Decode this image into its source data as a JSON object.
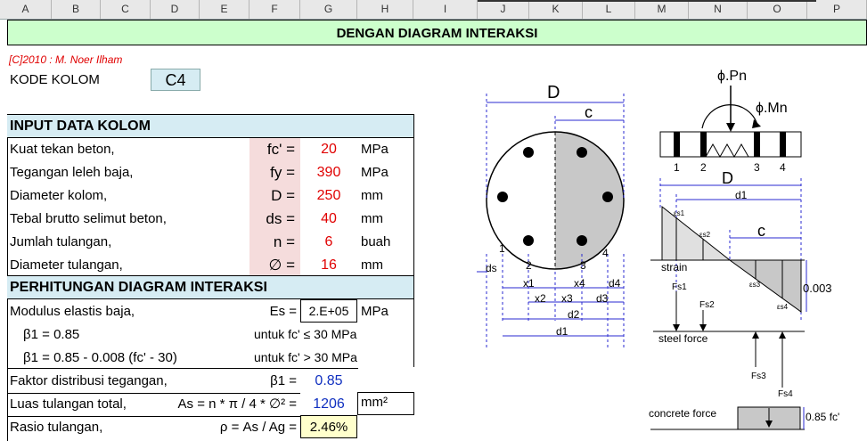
{
  "columns": [
    "A",
    "B",
    "C",
    "D",
    "E",
    "F",
    "G",
    "H",
    "I",
    "J",
    "K",
    "L",
    "M",
    "N",
    "O",
    "P"
  ],
  "title": "DENGAN DIAGRAM INTERAKSI",
  "credit": "[C]2010 : M. Noer Ilham",
  "kode": {
    "label": "KODE KOLOM",
    "value": "C4"
  },
  "input_header": "INPUT DATA KOLOM",
  "inputs": [
    {
      "label": "Kuat tekan beton,",
      "sym": "fc' =",
      "value": "20",
      "unit": "MPa"
    },
    {
      "label": "Tegangan leleh baja,",
      "sym": "fy =",
      "value": "390",
      "unit": "MPa"
    },
    {
      "label": "Diameter kolom,",
      "sym": "D =",
      "value": "250",
      "unit": "mm"
    },
    {
      "label": "Tebal brutto selimut beton,",
      "sym": "ds =",
      "value": "40",
      "unit": "mm"
    },
    {
      "label": "Jumlah tulangan,",
      "sym": "n =",
      "value": "6",
      "unit": "buah"
    },
    {
      "label": "Diameter tulangan,",
      "sym": "∅ =",
      "value": "16",
      "unit": "mm"
    }
  ],
  "calc_header": "PERHITUNGAN DIAGRAM INTERAKSI",
  "calc": {
    "modulus": {
      "label": "Modulus elastis baja,",
      "sym": "Es =",
      "value": "2.E+05",
      "unit": "MPa"
    },
    "beta_a": {
      "label": "β1 =  0.85",
      "cond": "untuk fc' ≤ 30 MPa"
    },
    "beta_b": {
      "label": "β1 =  0.85 - 0.008 (fc' - 30)",
      "cond": "untuk fc' > 30 MPa"
    },
    "faktor": {
      "label": "Faktor distribusi tegangan,",
      "sym": "β1 =",
      "value": "0.85"
    },
    "luas": {
      "label": "Luas tulangan total,",
      "formula": "As = n * π / 4 * ∅² =",
      "value": "1206",
      "unit": "mm²"
    },
    "rasio": {
      "label": "Rasio tulangan,",
      "formula": "ρ = As / Ag =",
      "value": "2.46%"
    }
  },
  "diagram": {
    "D": "D",
    "c": "c",
    "ds": "ds",
    "x1": "x1",
    "x2": "x2",
    "x3": "x3",
    "x4": "x4",
    "d1": "d1",
    "d2": "d2",
    "d3": "d3",
    "d4": "d4",
    "bars": [
      "1",
      "2",
      "3",
      "4"
    ],
    "phiPn": "ϕ.Pn",
    "phiMn": "ϕ.Mn",
    "strain": "strain",
    "strain_val": "0.003",
    "steel_force": "steel force",
    "concrete_force": "concrete force",
    "conc_val": "0.85 fc'",
    "eps": [
      "εs1",
      "εs2",
      "εs3",
      "εs4"
    ],
    "fs": [
      "Fs1",
      "Fs2",
      "Fs3",
      "Fs4"
    ]
  }
}
